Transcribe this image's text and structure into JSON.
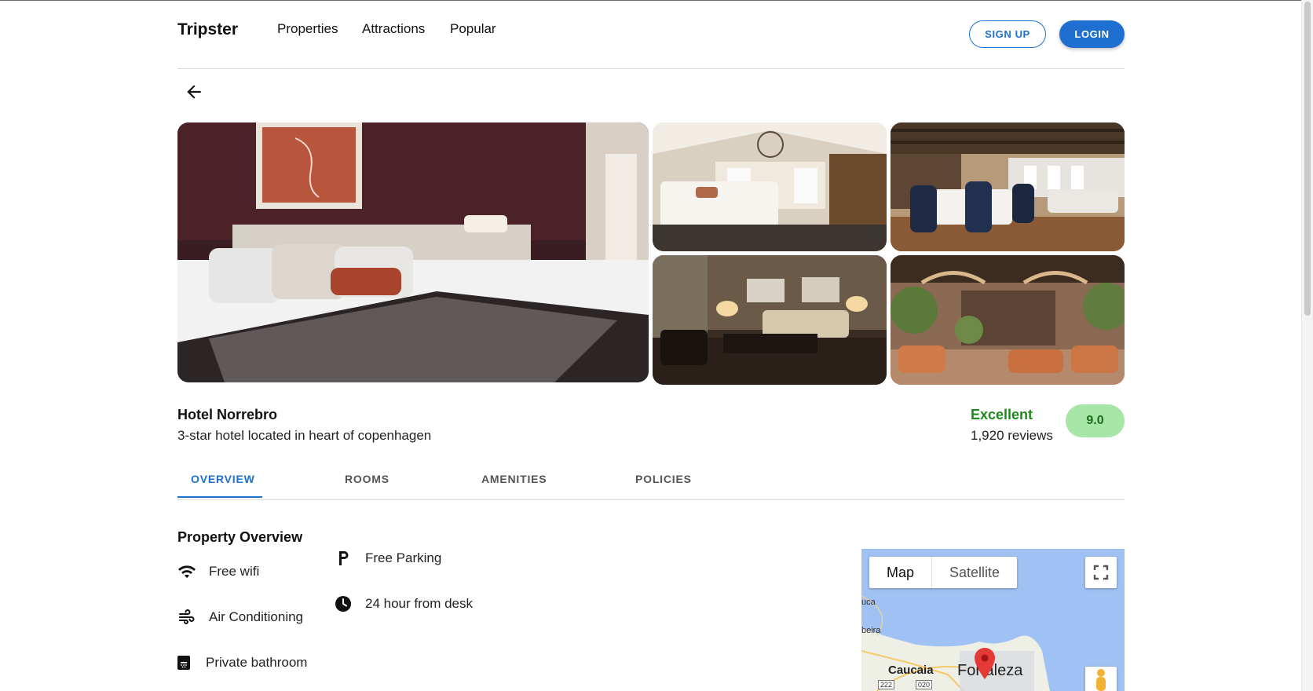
{
  "header": {
    "brand": "Tripster",
    "nav": [
      "Properties",
      "Attractions",
      "Popular"
    ],
    "signup_label": "SIGN UP",
    "login_label": "LOGIN"
  },
  "gallery": {
    "photos": [
      "bedroom-main",
      "suite-bedroom",
      "restaurant",
      "lounge",
      "lobby"
    ]
  },
  "hotel": {
    "name": "Hotel Norrebro",
    "description": "3-star hotel located in heart of copenhagen",
    "rating_label": "Excellent",
    "reviews": "1,920 reviews",
    "score": "9.0"
  },
  "tabs": [
    {
      "label": "OVERVIEW",
      "active": true
    },
    {
      "label": "ROOMS",
      "active": false
    },
    {
      "label": "AMENITIES",
      "active": false
    },
    {
      "label": "POLICIES",
      "active": false
    }
  ],
  "overview": {
    "title": "Property Overview",
    "amenities_left": [
      {
        "icon": "wifi-icon",
        "label": "Free wifi"
      },
      {
        "icon": "air-conditioning-icon",
        "label": "Air Conditioning"
      },
      {
        "icon": "bathroom-icon",
        "label": "Private bathroom"
      }
    ],
    "amenities_right": [
      {
        "icon": "parking-icon",
        "label": "Free Parking"
      },
      {
        "icon": "clock-icon",
        "label": "24 hour from desk"
      }
    ]
  },
  "map": {
    "map_label": "Map",
    "satellite_label": "Satellite",
    "labels": [
      "uca",
      "beira",
      "Caucaia",
      "Fortaleza",
      "222",
      "020"
    ]
  },
  "colors": {
    "accent": "#1f6fd1",
    "rating_green": "#1e8a1e",
    "score_bg": "#a6e6a6"
  }
}
